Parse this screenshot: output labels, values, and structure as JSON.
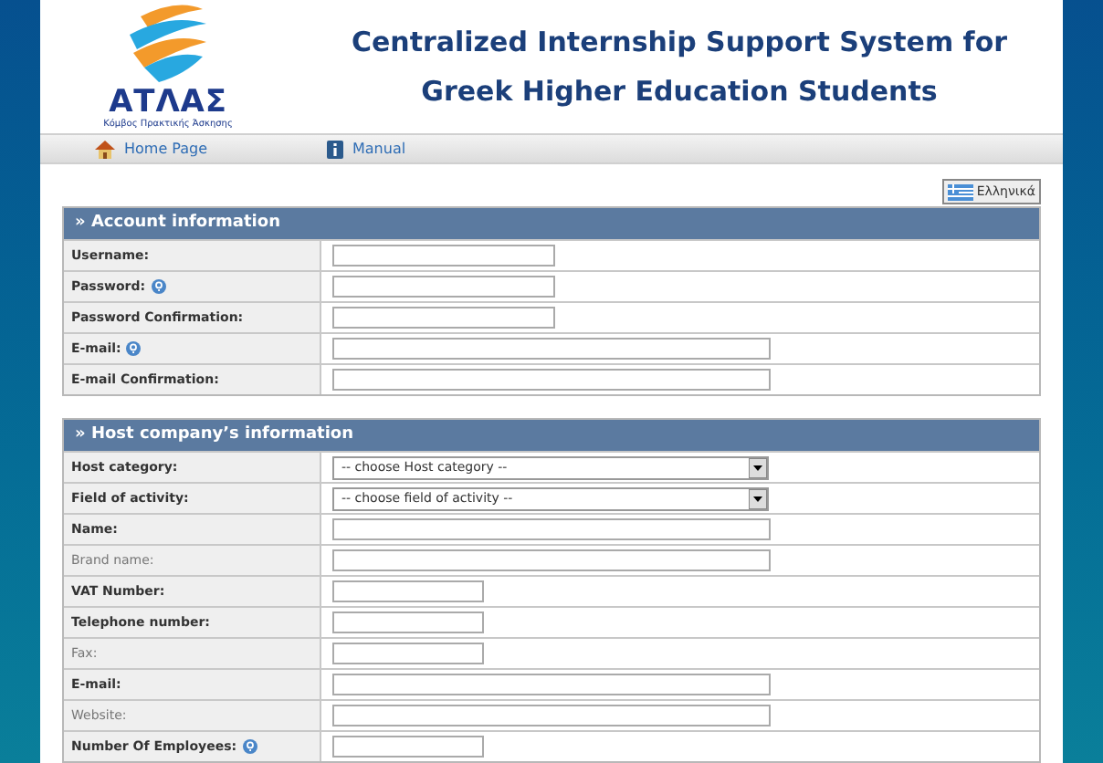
{
  "logo": {
    "name": "ΑΤΛΑΣ",
    "tagline": "Κόμβος Πρακτικής Άσκησης"
  },
  "title_lines": [
    "Centralized Internship Support System for",
    "Greek Higher Education Students"
  ],
  "nav": [
    {
      "label": "Home Page"
    },
    {
      "label": "Manual"
    }
  ],
  "language_button": "Ελληνικά",
  "sections": [
    {
      "title": "» Account information",
      "rows": [
        {
          "label": "Username:",
          "required": true,
          "help": false,
          "kind": "medium"
        },
        {
          "label": "Password:",
          "required": true,
          "help": true,
          "kind": "medium"
        },
        {
          "label": "Password Confirmation:",
          "required": true,
          "help": false,
          "kind": "medium"
        },
        {
          "label": "E-mail:",
          "required": true,
          "help": true,
          "kind": "long"
        },
        {
          "label": "E-mail Confirmation:",
          "required": true,
          "help": false,
          "kind": "long"
        }
      ]
    },
    {
      "title": "» Host company’s information",
      "rows": [
        {
          "label": "Host category:",
          "required": true,
          "help": false,
          "kind": "select",
          "value": "-- choose Host category --"
        },
        {
          "label": "Field of activity:",
          "required": true,
          "help": false,
          "kind": "select",
          "value": "-- choose field of activity --"
        },
        {
          "label": "Name:",
          "required": true,
          "help": false,
          "kind": "long"
        },
        {
          "label": "Brand name:",
          "required": false,
          "help": false,
          "kind": "long"
        },
        {
          "label": "VAT Number:",
          "required": true,
          "help": false,
          "kind": "short"
        },
        {
          "label": "Telephone number:",
          "required": true,
          "help": false,
          "kind": "short"
        },
        {
          "label": "Fax:",
          "required": false,
          "help": false,
          "kind": "short"
        },
        {
          "label": "E-mail:",
          "required": true,
          "help": false,
          "kind": "long"
        },
        {
          "label": "Website:",
          "required": false,
          "help": false,
          "kind": "long"
        },
        {
          "label": "Number Of Employees:",
          "required": true,
          "help": true,
          "kind": "short"
        }
      ]
    }
  ]
}
